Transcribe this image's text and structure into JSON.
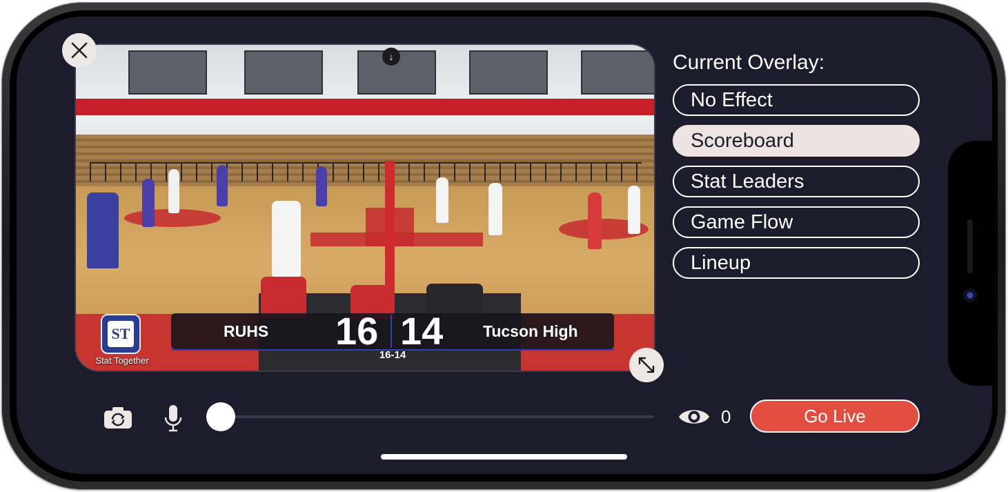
{
  "overlay_panel": {
    "title": "Current Overlay:",
    "options": [
      {
        "label": "No Effect",
        "selected": false
      },
      {
        "label": "Scoreboard",
        "selected": true
      },
      {
        "label": "Stat Leaders",
        "selected": false
      },
      {
        "label": "Game Flow",
        "selected": false
      },
      {
        "label": "Lineup",
        "selected": false
      }
    ]
  },
  "scoreboard": {
    "home_team": "RUHS",
    "home_score": "16",
    "away_score": "14",
    "away_team": "Tucson High",
    "set_score": "16-14",
    "logo_text": "ST",
    "logo_caption": "Stat Together"
  },
  "controls": {
    "viewer_count": "0",
    "go_live_label": "Go Live"
  },
  "icons": {
    "close": "close-icon",
    "expand": "expand-icon",
    "download": "download-icon",
    "flip_camera": "camera-flip-icon",
    "microphone": "microphone-icon",
    "viewers": "eye-icon"
  },
  "colors": {
    "screen_bg": "#1c1c2d",
    "go_live": "#e14e3f",
    "selected_option": "#ede4e1",
    "scoreboard_accent": "#3040b0"
  }
}
